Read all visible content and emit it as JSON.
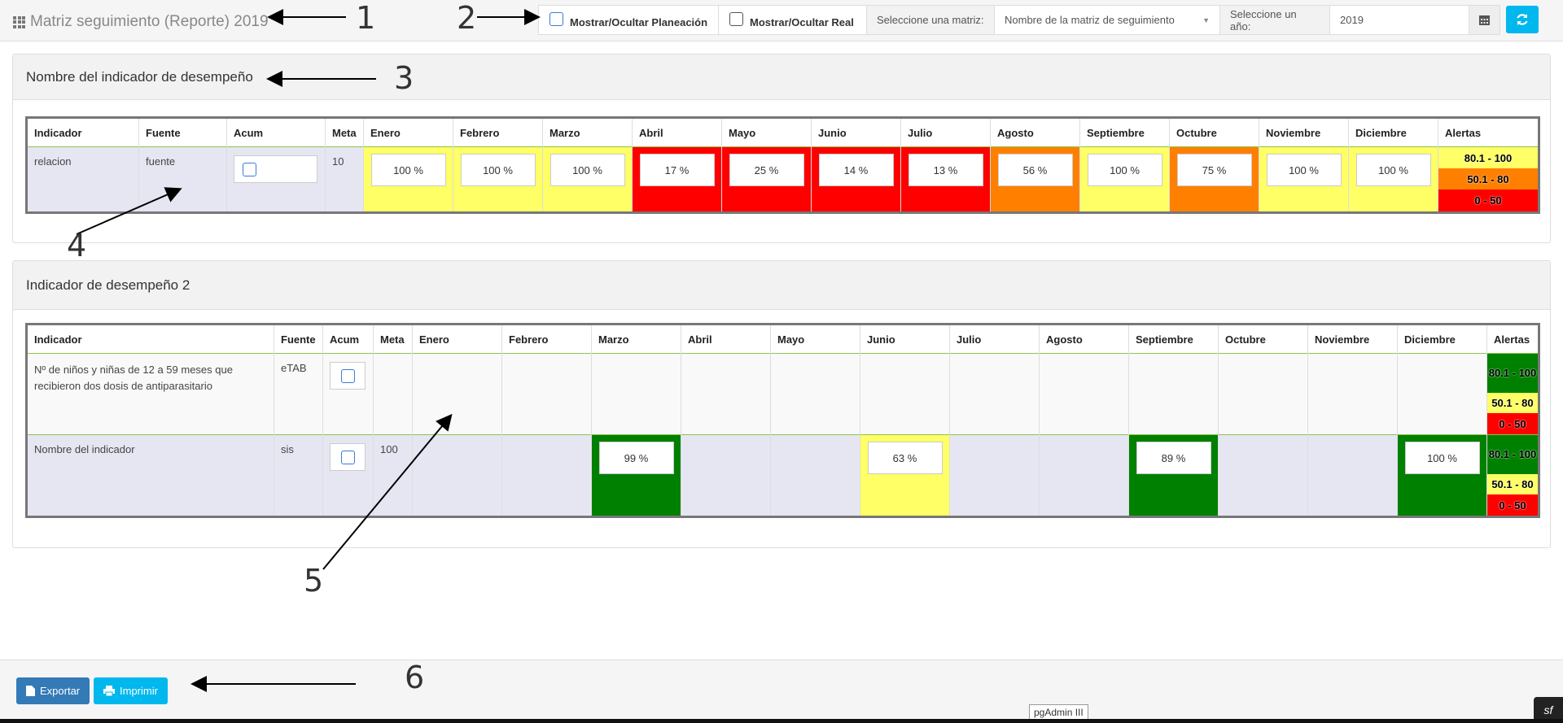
{
  "header": {
    "title": "Matriz seguimiento (Reporte) 2019",
    "toggle_planeacion": "Mostrar/Ocultar Planeación",
    "toggle_real": "Mostrar/Ocultar Real",
    "matrix_label": "Seleccione una matriz:",
    "matrix_value": "Nombre de la matriz de seguimiento",
    "year_label": "Seleccione un año:",
    "year_value": "2019"
  },
  "columns": [
    "Indicador",
    "Fuente",
    "Acum",
    "Meta",
    "Enero",
    "Febrero",
    "Marzo",
    "Abril",
    "Mayo",
    "Junio",
    "Julio",
    "Agosto",
    "Septiembre",
    "Octubre",
    "Noviembre",
    "Diciembre",
    "Alertas"
  ],
  "alerts": [
    "80.1 - 100",
    "50.1 - 80",
    "0 - 50"
  ],
  "colors": {
    "red": "#ff0000",
    "orange": "#ff8000",
    "yellow": "#ffff66",
    "green": "#008000",
    "row_blue": "#e6e6f3"
  },
  "panel1": {
    "title": "Nombre del indicador de desempeño",
    "row": {
      "indicador": "relacion",
      "fuente": "fuente",
      "meta": "10",
      "months": [
        "100 %",
        "100 %",
        "100 %",
        "17 %",
        "25 %",
        "14 %",
        "13 %",
        "56 %",
        "100 %",
        "75 %",
        "100 %",
        "100 %"
      ]
    }
  },
  "panel2": {
    "title": "Indicador de desempeño 2",
    "row1": {
      "indicador": "Nº de niños y niñas de 12 a 59 meses que recibieron dos dosis de antiparasitario",
      "fuente": "eTAB",
      "meta": ""
    },
    "row2": {
      "indicador": "Nombre del indicador",
      "fuente": "sis",
      "meta": "100",
      "marzo": "99 %",
      "junio": "63 %",
      "septiembre": "89 %",
      "diciembre": "100 %"
    }
  },
  "footer": {
    "export": "Exportar",
    "print": "Imprimir"
  },
  "tooltip": "pgAdmin III",
  "annotations": [
    "1",
    "2",
    "3",
    "4",
    "5",
    "6"
  ]
}
